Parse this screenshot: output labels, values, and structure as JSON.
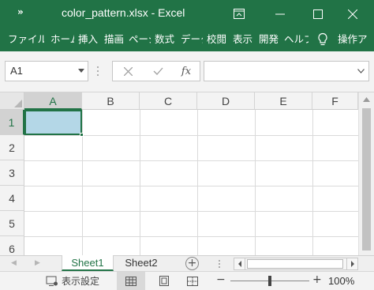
{
  "window": {
    "quick_access": "»",
    "title": "color_pattern.xlsx - Excel"
  },
  "ribbon": {
    "tabs": [
      "ファイル",
      "ホーム",
      "挿入",
      "描画",
      "ページ",
      "数式",
      "データ",
      "校閲",
      "表示",
      "開発",
      "ヘルプ"
    ],
    "search_label": "操作ア"
  },
  "formula_bar": {
    "name_box": "A1",
    "formula": ""
  },
  "grid": {
    "columns": [
      "A",
      "B",
      "C",
      "D",
      "E",
      "F"
    ],
    "rows": [
      "1",
      "2",
      "3",
      "4",
      "5",
      "6"
    ],
    "selected_cell": "A1",
    "selected_fill": "#b4d7e7"
  },
  "sheets": {
    "tabs": [
      "Sheet1",
      "Sheet2"
    ],
    "active": "Sheet1"
  },
  "status_bar": {
    "display_settings": "表示設定",
    "zoom": "100%"
  },
  "colors": {
    "accent": "#217346"
  }
}
